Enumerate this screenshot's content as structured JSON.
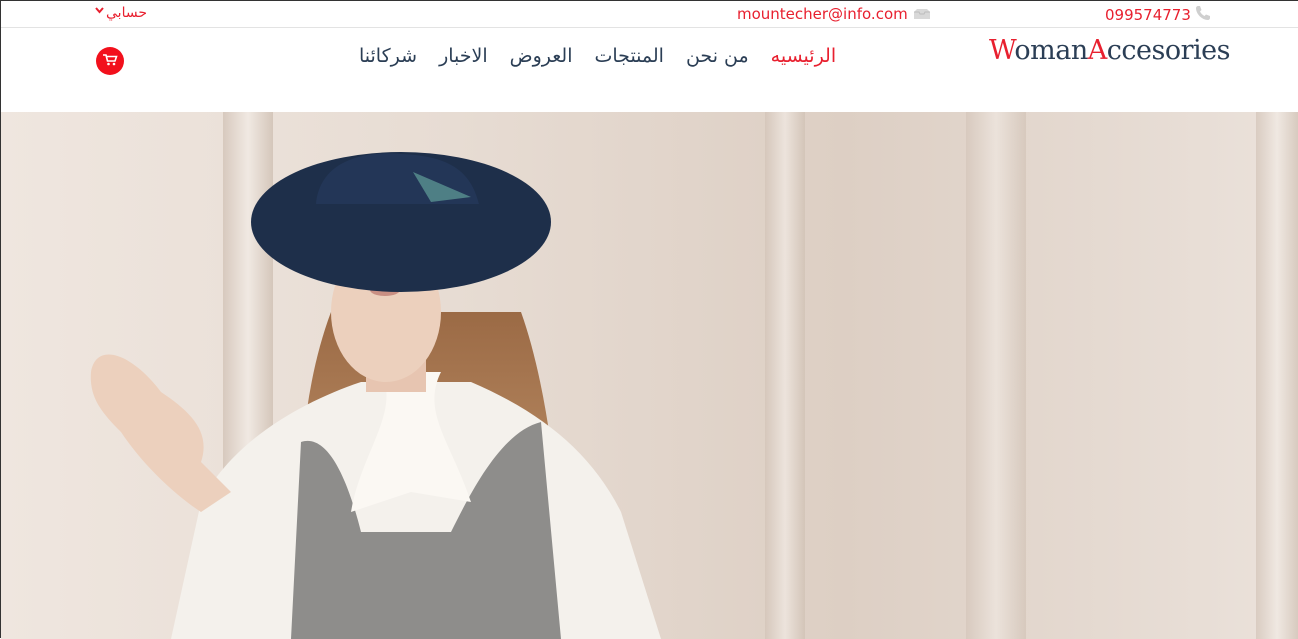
{
  "topbar": {
    "account_label": "حسابي",
    "email": "mountecher@info.com",
    "phone": "099574773"
  },
  "logo": {
    "first_initial": "W",
    "first_rest": "oman",
    "second_initial": "A",
    "second_rest": "ccesories"
  },
  "nav": {
    "items": [
      "الرئيسيه",
      "من نحن",
      "المنتجات",
      "العروض",
      "الاخبار",
      "شركائنا"
    ],
    "active_index": 0
  },
  "colors": {
    "accent": "#e8202f",
    "nav_text": "#2b3e55"
  },
  "icons": {
    "account": "chevron-down-icon",
    "email": "envelope-icon",
    "phone": "phone-icon",
    "cart": "shopping-cart-icon"
  },
  "hero": {
    "image": "woman-in-navy-hat-photo"
  }
}
